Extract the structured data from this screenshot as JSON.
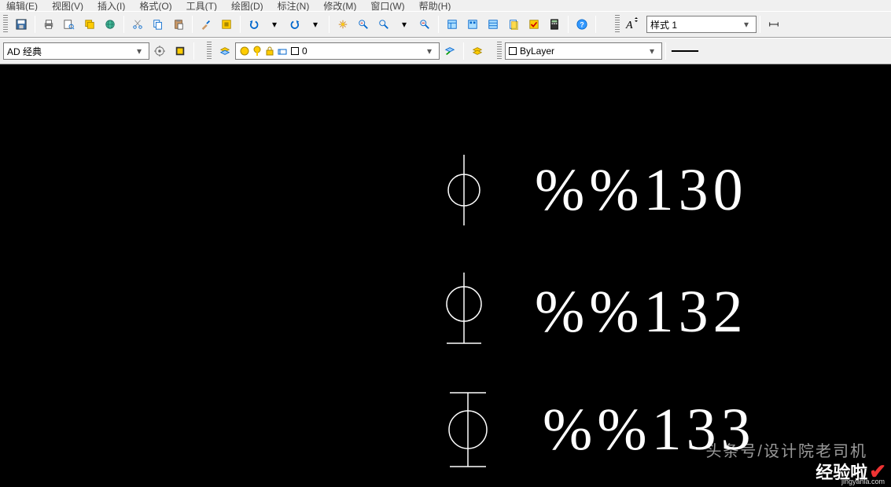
{
  "menu": {
    "items": [
      "编辑(E)",
      "视图(V)",
      "插入(I)",
      "格式(O)",
      "工具(T)",
      "绘图(D)",
      "标注(N)",
      "修改(M)",
      "窗口(W)",
      "帮助(H)"
    ]
  },
  "toolbar1": {
    "style_dropdown": "样式 1"
  },
  "toolbar2": {
    "workspace": "AD 经典",
    "layer": "0",
    "color": "ByLayer"
  },
  "drawing": {
    "row1": {
      "code": "%%130"
    },
    "row2": {
      "code": "%%132"
    },
    "row3": {
      "code": "%%133"
    }
  },
  "watermark": {
    "line1": "头条号/设计院老司机",
    "brand": "经验啦",
    "sub": "jingyanla.com"
  },
  "colors": {
    "bg": "#f0f0f0",
    "canvas": "#000000"
  }
}
